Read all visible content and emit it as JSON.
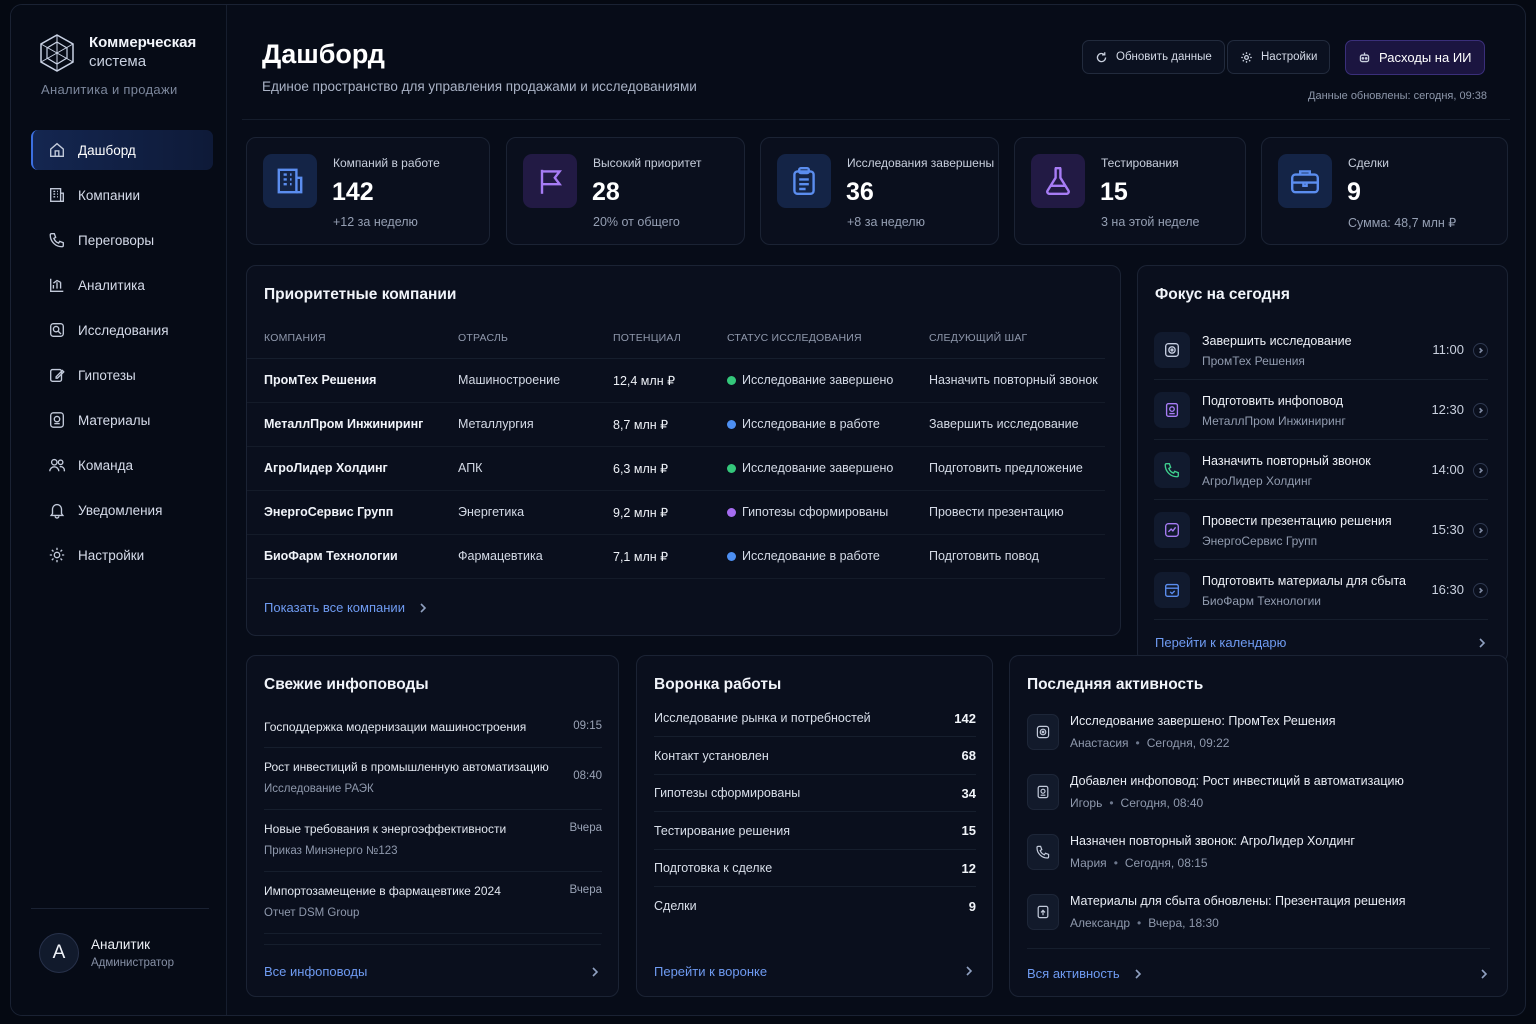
{
  "brand": {
    "name_line1": "Коммерческая",
    "name_line2": "система",
    "subtitle": "Аналитика и продажи"
  },
  "nav": [
    {
      "label": "Дашборд",
      "icon": "home-icon",
      "active": true
    },
    {
      "label": "Компании",
      "icon": "building-icon"
    },
    {
      "label": "Переговоры",
      "icon": "phone-icon"
    },
    {
      "label": "Аналитика",
      "icon": "chart-icon"
    },
    {
      "label": "Исследования",
      "icon": "research-icon"
    },
    {
      "label": "Гипотезы",
      "icon": "edit-icon"
    },
    {
      "label": "Материалы",
      "icon": "materials-icon"
    },
    {
      "label": "Команда",
      "icon": "team-icon"
    },
    {
      "label": "Уведомления",
      "icon": "bell-icon"
    },
    {
      "label": "Настройки",
      "icon": "gear-icon"
    }
  ],
  "user": {
    "initial": "А",
    "name": "Аналитик",
    "role": "Администратор"
  },
  "header": {
    "title": "Дашборд",
    "subtitle": "Единое пространство для управления продажами и исследованиями",
    "refresh_label": "Обновить данные",
    "settings_label": "Настройки",
    "ai_label": "Расходы на ИИ",
    "updated": "Данные обновлены: сегодня, 09:38"
  },
  "kpis": [
    {
      "label": "Компаний в работе",
      "value": "142",
      "sub": "+12 за неделю",
      "icon": "building-icon",
      "color": "#5b8def"
    },
    {
      "label": "Высокий приоритет",
      "value": "28",
      "sub": "20% от общего",
      "icon": "flag-icon",
      "color": "#a77cf5"
    },
    {
      "label": "Исследования завершены",
      "value": "36",
      "sub": "+8 за неделю",
      "icon": "clipboard-icon",
      "color": "#5b8def"
    },
    {
      "label": "Тестирования",
      "value": "15",
      "sub": "3 на этой неделе",
      "icon": "flask-icon",
      "color": "#a77cf5"
    },
    {
      "label": "Сделки",
      "value": "9",
      "sub": "Сумма: 48,7 млн ₽",
      "icon": "briefcase-icon",
      "color": "#5b8def"
    }
  ],
  "priority": {
    "title": "Приоритетные компании",
    "columns": [
      "КОМПАНИЯ",
      "ОТРАСЛЬ",
      "ПОТЕНЦИАЛ",
      "СТАТУС ИССЛЕДОВАНИЯ",
      "СЛЕДУЮЩИЙ ШАГ"
    ],
    "rows": [
      {
        "company": "ПромТех Решения",
        "industry": "Машиностроение",
        "potential": "12,4 млн ₽",
        "status": "Исследование завершено",
        "status_color": "#34c77b",
        "next": "Назначить повторный звонок"
      },
      {
        "company": "МеталлПром Инжиниринг",
        "industry": "Металлургия",
        "potential": "8,7 млн ₽",
        "status": "Исследование в работе",
        "status_color": "#4d8ff2",
        "next": "Завершить исследование"
      },
      {
        "company": "АгроЛидер Холдинг",
        "industry": "АПК",
        "potential": "6,3 млн ₽",
        "status": "Исследование завершено",
        "status_color": "#34c77b",
        "next": "Подготовить предложение"
      },
      {
        "company": "ЭнергоСервис Групп",
        "industry": "Энергетика",
        "potential": "9,2 млн ₽",
        "status": "Гипотезы сформированы",
        "status_color": "#a56cf0",
        "next": "Провести презентацию"
      },
      {
        "company": "БиоФарм Технологии",
        "industry": "Фармацевтика",
        "potential": "7,1 млн ₽",
        "status": "Исследование в работе",
        "status_color": "#4d8ff2",
        "next": "Подготовить повод"
      }
    ],
    "link": "Показать все компании"
  },
  "focus": {
    "title": "Фокус на сегодня",
    "items": [
      {
        "title": "Завершить исследование",
        "sub": "ПромТех Решения",
        "time": "11:00",
        "icon": "target-icon",
        "color": "#c5cde0"
      },
      {
        "title": "Подготовить инфоповод",
        "sub": "МеталлПром Инжиниринг",
        "time": "12:30",
        "icon": "document-icon",
        "color": "#a77cf5"
      },
      {
        "title": "Назначить повторный звонок",
        "sub": "АгроЛидер Холдинг",
        "time": "14:00",
        "icon": "phone-icon",
        "color": "#3fcf8e"
      },
      {
        "title": "Провести презентацию решения",
        "sub": "ЭнергоСервис Групп",
        "time": "15:30",
        "icon": "presentation-icon",
        "color": "#a77cf5"
      },
      {
        "title": "Подготовить материалы для сбыта",
        "sub": "БиоФарм Технологии",
        "time": "16:30",
        "icon": "package-icon",
        "color": "#5b8def"
      }
    ],
    "link": "Перейти к календарю"
  },
  "news": {
    "title": "Свежие инфоповоды",
    "items": [
      {
        "title": "Господдержка модернизации машиностроения",
        "sub": "",
        "time": "09:15"
      },
      {
        "title": "Рост инвестиций в промышленную автоматизацию",
        "sub": "Исследование РАЭК",
        "time": "08:40"
      },
      {
        "title": "Новые требования к энергоэффективности",
        "sub": "Приказ Минэнерго №123",
        "time": "Вчера"
      },
      {
        "title": "Импортозамещение в фармацевтике 2024",
        "sub": "Отчет DSM Group",
        "time": "Вчера"
      }
    ],
    "link": "Все инфоповоды"
  },
  "funnel": {
    "title": "Воронка работы",
    "rows": [
      {
        "label": "Исследование рынка и потребностей",
        "value": "142"
      },
      {
        "label": "Контакт установлен",
        "value": "68"
      },
      {
        "label": "Гипотезы сформированы",
        "value": "34"
      },
      {
        "label": "Тестирование решения",
        "value": "15"
      },
      {
        "label": "Подготовка к сделке",
        "value": "12"
      },
      {
        "label": "Сделки",
        "value": "9"
      }
    ],
    "link": "Перейти к воронке"
  },
  "activity": {
    "title": "Последняя активность",
    "items": [
      {
        "title": "Исследование завершено: ПромТех Решения",
        "who": "Анастасия",
        "when": "Сегодня, 09:22",
        "icon": "target-icon"
      },
      {
        "title": "Добавлен инфоповод: Рост инвестиций в автоматизацию",
        "who": "Игорь",
        "when": "Сегодня, 08:40",
        "icon": "document-icon"
      },
      {
        "title": "Назначен повторный звонок: АгроЛидер Холдинг",
        "who": "Мария",
        "when": "Сегодня, 08:15",
        "icon": "phone-icon"
      },
      {
        "title": "Материалы для сбыта обновлены: Презентация решения",
        "who": "Александр",
        "when": "Вчера, 18:30",
        "icon": "upload-icon"
      }
    ],
    "link": "Вся активность"
  }
}
